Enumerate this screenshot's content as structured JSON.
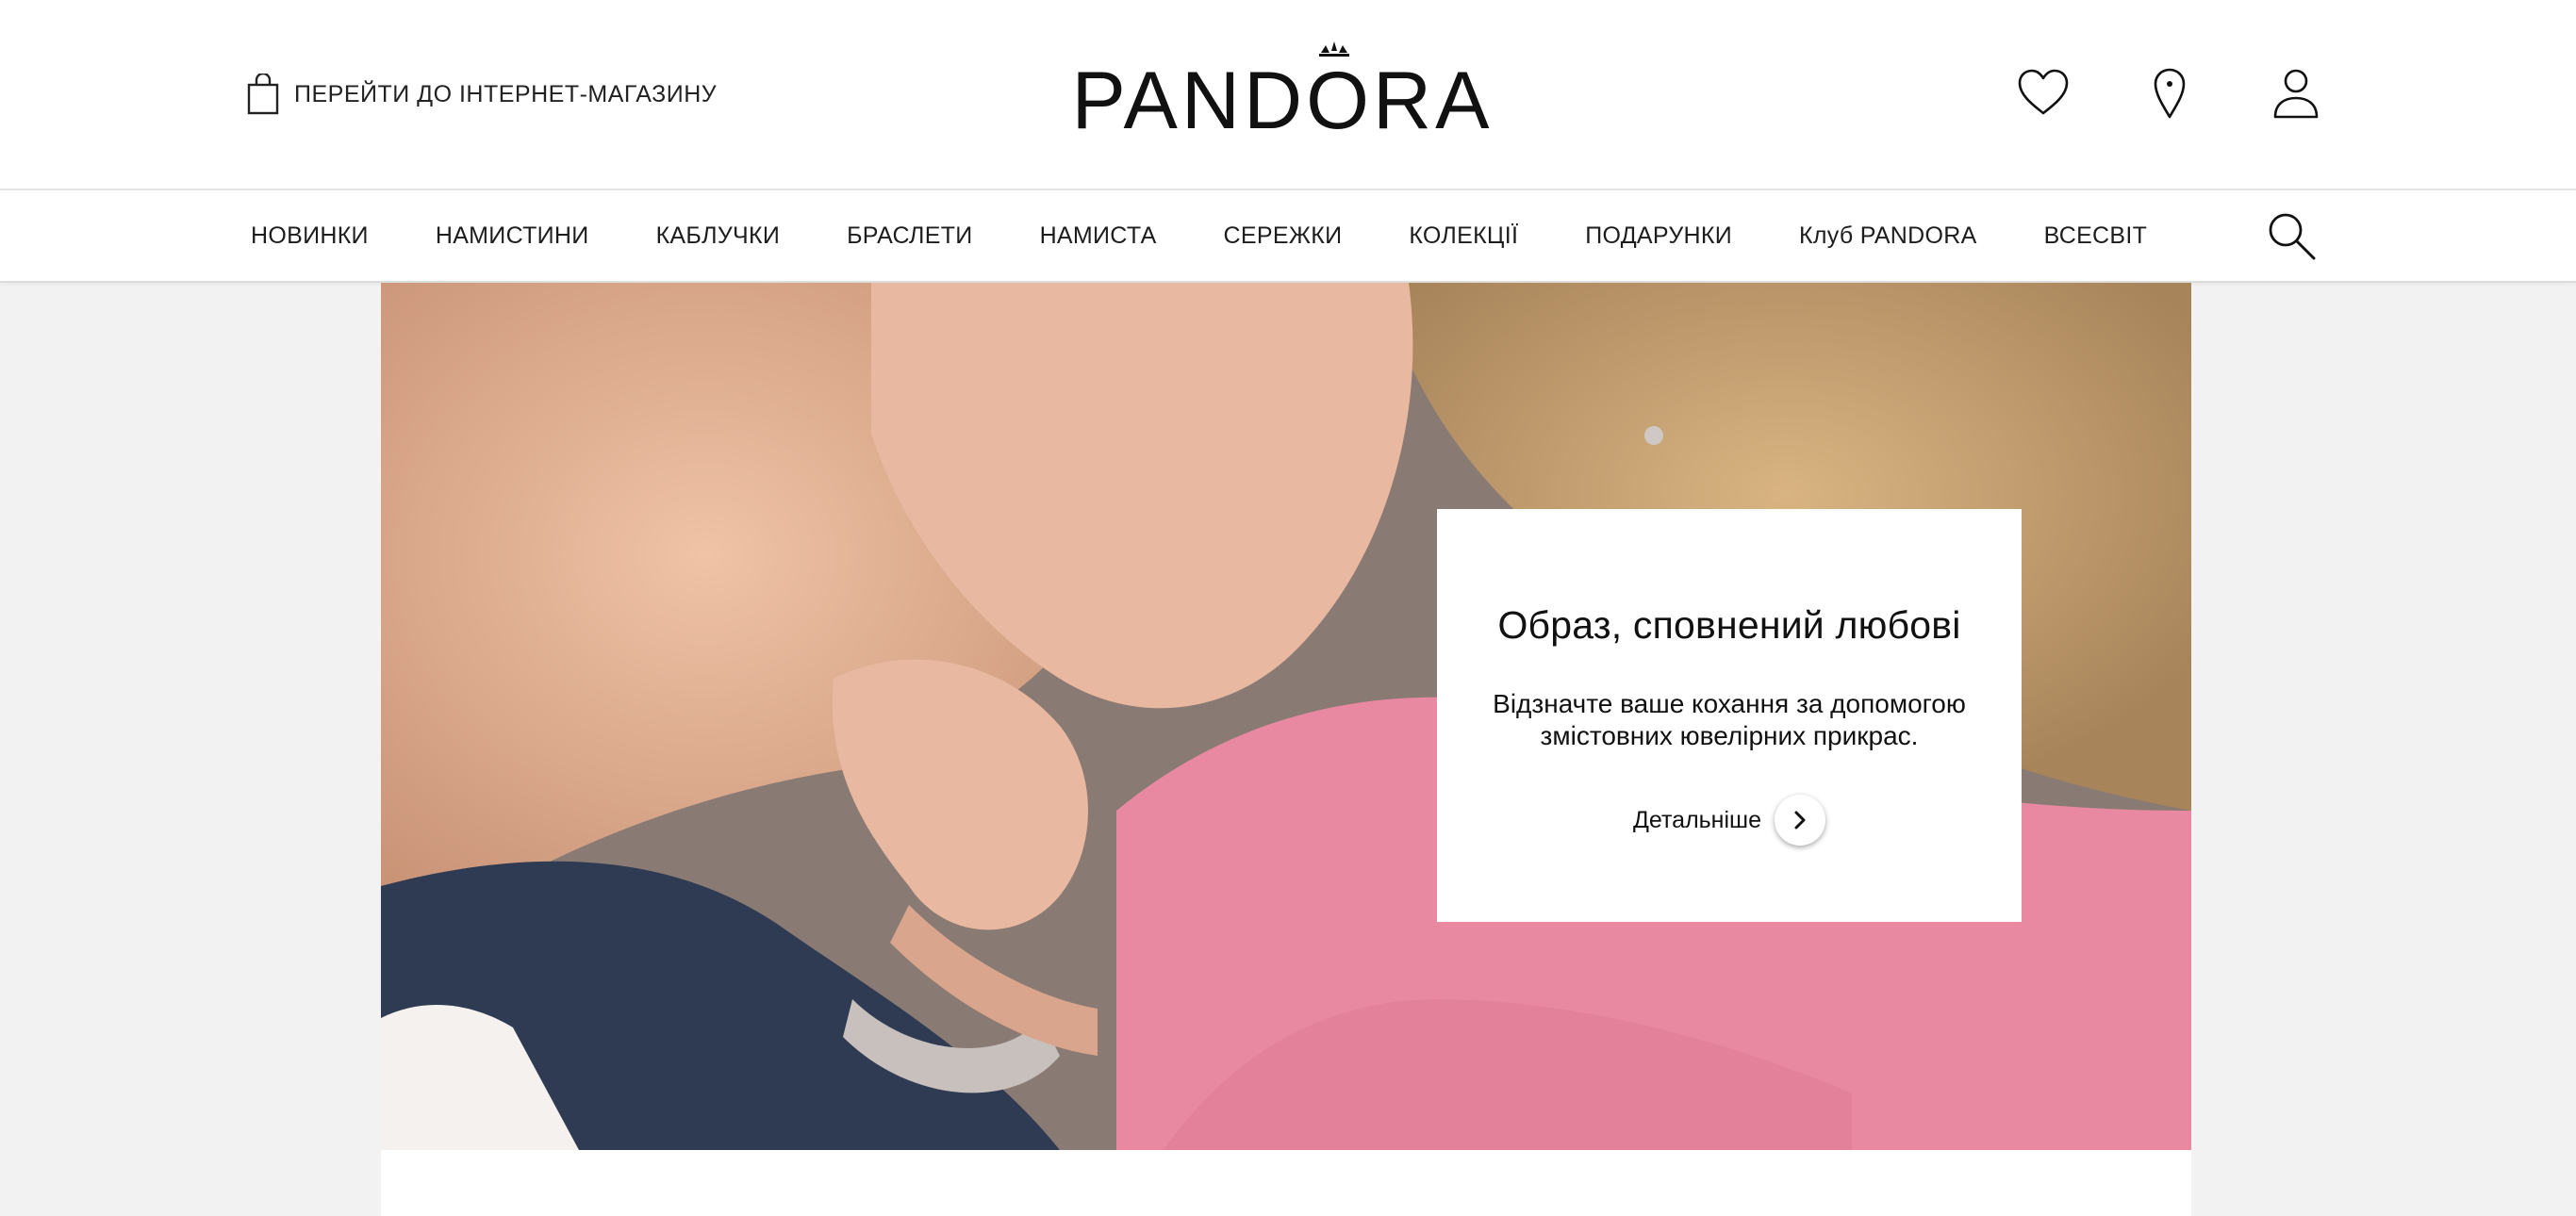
{
  "header": {
    "shop_link_label": "ПЕРЕЙТИ ДО ІНТЕРНЕТ-МАГАЗИНУ",
    "logo_text": "PANDORA",
    "icons": [
      "shopping-bag-icon",
      "heart-icon",
      "location-pin-icon",
      "user-icon"
    ]
  },
  "nav": {
    "items": [
      {
        "label": "НОВИНКИ"
      },
      {
        "label": "НАМИСТИНИ"
      },
      {
        "label": "КАБЛУЧКИ"
      },
      {
        "label": "БРАСЛЕТИ"
      },
      {
        "label": "НАМИСТА"
      },
      {
        "label": "СЕРЕЖКИ"
      },
      {
        "label": "КОЛЕКЦІЇ"
      },
      {
        "label": "ПОДАРУНКИ"
      },
      {
        "label": "Клуб PANDORA"
      },
      {
        "label": "ВСЕСВІТ"
      }
    ],
    "search_icon": "search-icon"
  },
  "hero": {
    "title": "Образ, сповнений любові",
    "text": "Відзначте ваше кохання за допомогою змістовних ювелірних прикрас.",
    "cta_label": "Детальніше",
    "cta_icon": "chevron-right-icon"
  },
  "colors": {
    "background": "#f2f2f3",
    "header_bg": "#ffffff",
    "text": "#1a1a1a",
    "hero_pink": "#e57f9b"
  }
}
